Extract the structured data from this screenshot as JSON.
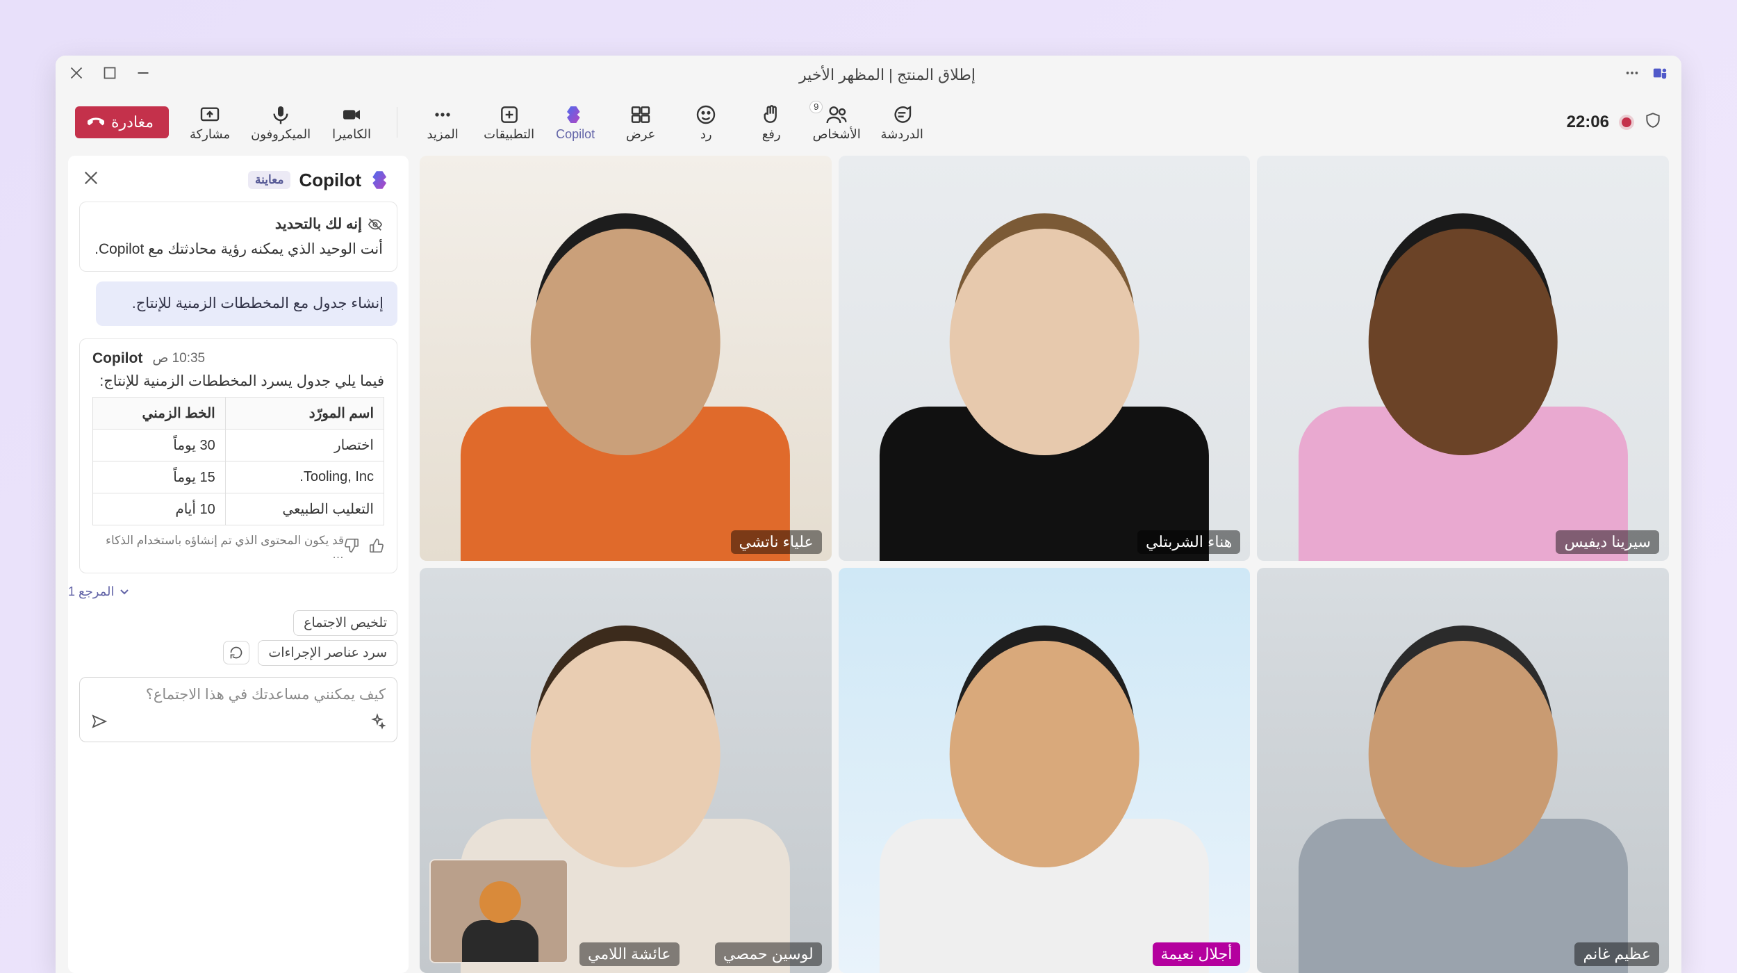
{
  "window": {
    "title": "إطلاق المنتج | المظهر الأخير"
  },
  "toolbar": {
    "leave": "مغادرة",
    "share": "مشاركة",
    "mic": "الميكروفون",
    "camera": "الكاميرا",
    "more": "المزيد",
    "apps": "التطبيقات",
    "copilot": "Copilot",
    "view": "عرض",
    "react": "رد",
    "raise": "رفع",
    "people": "الأشخاص",
    "people_count": "9",
    "chat": "الدردشة",
    "timer": "22:06"
  },
  "panel": {
    "title": "Copilot",
    "preview": "معاينة",
    "info_title": "إنه لك بالتحديد",
    "info_body": "أنت الوحيد الذي يمكنه رؤية محادثتك مع Copilot.",
    "user_prompt": "إنشاء جدول مع المخططات الزمنية للإنتاج.",
    "bot_name": "Copilot",
    "bot_time": "10:35 ص",
    "bot_intro": "فيما يلي جدول يسرد المخططات الزمنية للإنتاج:",
    "table": {
      "headers": [
        "اسم المورّد",
        "الخط الزمني"
      ],
      "rows": [
        [
          "اختصار",
          "30 يوماً"
        ],
        [
          "Tooling, Inc.",
          "15 يوماً"
        ],
        [
          "التعليب الطبيعي",
          "10 أيام"
        ]
      ]
    },
    "ai_disclaimer": "قد يكون المحتوى الذي تم إنشاؤه باستخدام الذكاء …",
    "reference": "المرجع 1",
    "chip_summarize": "تلخيص الاجتماع",
    "chip_actions": "سرد عناصر الإجراءات",
    "composer_placeholder": "كيف يمكنني مساعدتك في هذا الاجتماع؟"
  },
  "participants": [
    {
      "name": "علياء ناتشي",
      "bg": "bg-room",
      "skin": "#caa07a",
      "hair": "#1d1d1d",
      "shirt": "#e06a2b"
    },
    {
      "name": "هناء الشربتلي",
      "bg": "bg-office",
      "skin": "#e7c9ad",
      "hair": "#7b5a36",
      "shirt": "#111111"
    },
    {
      "name": "سيرينا ديفيس",
      "bg": "bg-office",
      "skin": "#6b4327",
      "hair": "#1a1a1a",
      "shirt": "#e9a9d0"
    },
    {
      "name": "لوسين حمصي",
      "bg": "bg-blur",
      "skin": "#e9cdb2",
      "hair": "#3c2b1c",
      "shirt": "#e9e1d7",
      "pip": true,
      "second_name": "عائشة اللامي"
    },
    {
      "name": "أجلال نعيمة",
      "bg": "bg-window",
      "skin": "#d9a97b",
      "hair": "#1e1e1e",
      "shirt": "#efefef",
      "highlight": true
    },
    {
      "name": "عظيم غانم",
      "bg": "bg-blur",
      "skin": "#c99b72",
      "hair": "#2b2b2b",
      "shirt": "#9aa3ad"
    }
  ]
}
